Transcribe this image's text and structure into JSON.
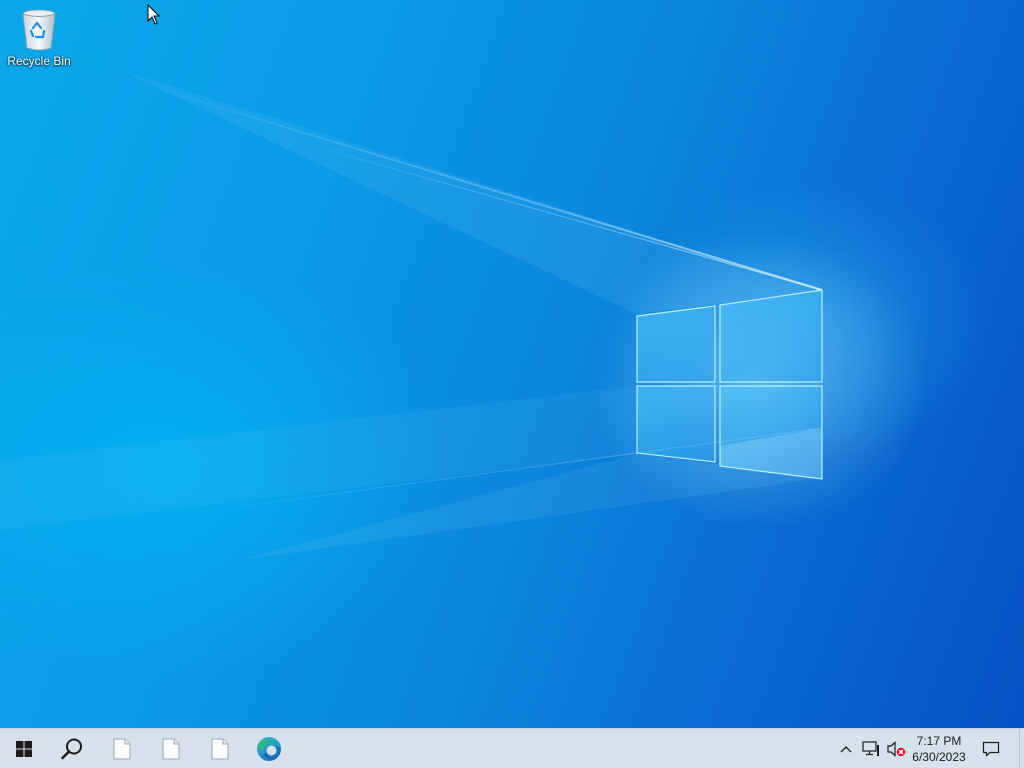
{
  "desktop": {
    "icons": [
      {
        "label": "Recycle Bin",
        "icon": "recycle-bin-icon"
      }
    ],
    "wallpaper": "windows-10-logo-light-beams"
  },
  "taskbar": {
    "start": {
      "icon": "windows-logo-icon"
    },
    "search": {
      "icon": "search-icon"
    },
    "pinned": [
      {
        "icon": "blank-file-icon"
      },
      {
        "icon": "blank-file-icon"
      },
      {
        "icon": "blank-file-icon"
      },
      {
        "icon": "edge-browser-icon"
      }
    ],
    "tray": {
      "chevron": {
        "icon": "chevron-up-icon"
      },
      "network": {
        "icon": "network-icon"
      },
      "volume": {
        "icon": "volume-muted-icon"
      },
      "clock": {
        "time": "7:17 PM",
        "date": "6/30/2023"
      },
      "notifications": {
        "icon": "action-center-icon"
      }
    }
  },
  "colors": {
    "taskbar_bg": "#d6e1ec",
    "wallpaper_left": "#0aa8ec",
    "wallpaper_right": "#0550c3",
    "edge_blue": "#0c59a4",
    "edge_green": "#36c06b"
  }
}
